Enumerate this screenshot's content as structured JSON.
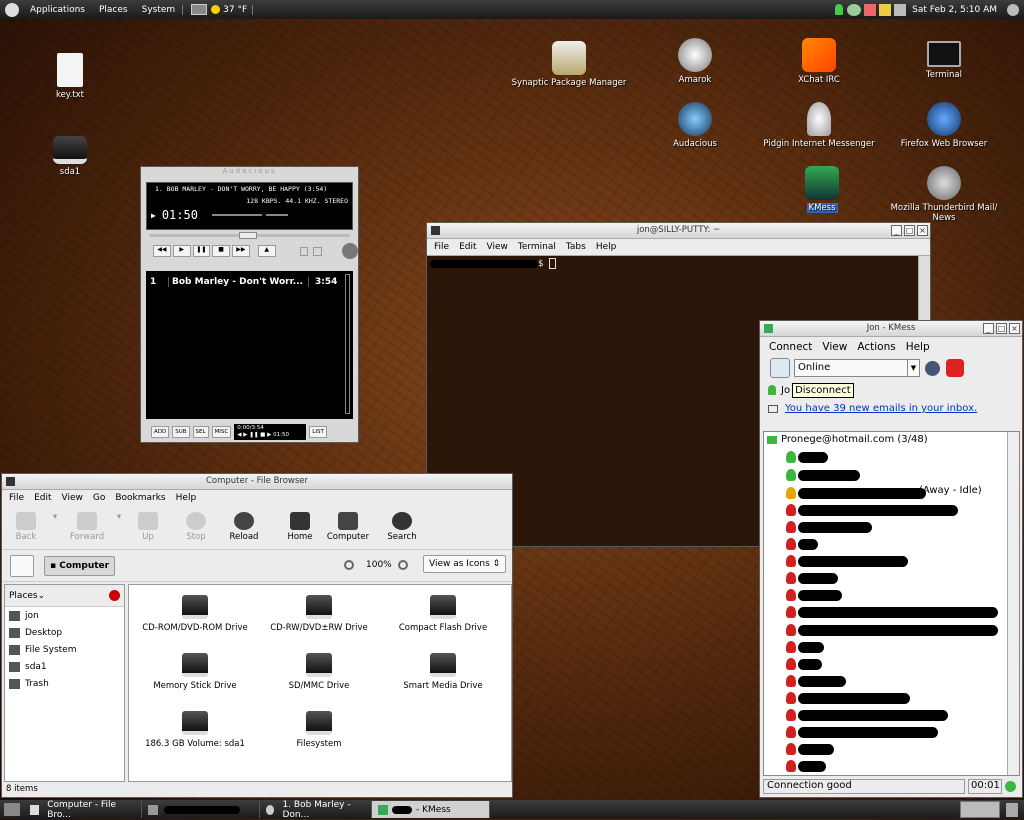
{
  "top_panel": {
    "menus": [
      "Applications",
      "Places",
      "System"
    ],
    "weather": "37 °F",
    "clock": "Sat Feb  2,  5:10 AM"
  },
  "desktop_icons": [
    {
      "label": "key.txt"
    },
    {
      "label": "sda1"
    },
    {
      "label": "Synaptic Package Manager"
    },
    {
      "label": "Amarok"
    },
    {
      "label": "XChat IRC"
    },
    {
      "label": "Terminal"
    },
    {
      "label": "Audacious"
    },
    {
      "label": "Pidgin Internet Messenger"
    },
    {
      "label": "Firefox Web Browser"
    },
    {
      "label": "KMess"
    },
    {
      "label": "Mozilla Thunderbird Mail/ News"
    }
  ],
  "audacious": {
    "track_info": "1. BOB MARLEY - DON'T WORRY, BE HAPPY (3:54)",
    "bitrate": "128 KBPS. 44.1 KHZ. STEREO",
    "time": "01:50",
    "playlist": [
      {
        "num": "1",
        "title": "Bob Marley - Don't Worr...",
        "duration": "3:54"
      }
    ],
    "pl_buttons": [
      "ADD",
      "SUB",
      "SEL",
      "MISC",
      "LIST"
    ],
    "pl_time": "0:00/3:54",
    "pl_elapsed": "01:50"
  },
  "terminal": {
    "title": "jon@SILLY-PUTTY: ~",
    "menus": [
      "File",
      "Edit",
      "View",
      "Terminal",
      "Tabs",
      "Help"
    ],
    "prompt": "$ "
  },
  "file_browser": {
    "title": "Computer - File Browser",
    "menus": [
      "File",
      "Edit",
      "View",
      "Go",
      "Bookmarks",
      "Help"
    ],
    "toolbar": [
      "Back",
      "Forward",
      "Up",
      "Stop",
      "Reload",
      "Home",
      "Computer",
      "Search"
    ],
    "location": "Computer",
    "zoom": "100%",
    "view_mode": "View as Icons",
    "places_label": "Places",
    "places": [
      "jon",
      "Desktop",
      "File System",
      "sda1",
      "Trash"
    ],
    "items": [
      "CD-ROM/DVD-ROM Drive",
      "CD-RW/DVD±RW Drive",
      "Compact Flash Drive",
      "Memory Stick Drive",
      "SD/MMC Drive",
      "Smart Media Drive",
      "186.3 GB Volume: sda1",
      "Filesystem"
    ],
    "status": "8 items"
  },
  "kmess": {
    "title": "Jon - KMess",
    "menus": [
      "Connect",
      "View",
      "Actions",
      "Help"
    ],
    "status_select": "Online",
    "tooltip": "Disconnect",
    "name_prefix": "Jo",
    "email_notice": "You have 39 new emails in your inbox.",
    "group": "Pronege@hotmail.com (3/48)",
    "away_text": "(Away - Idle)",
    "status_bar": "Connection good",
    "timer": "00:01"
  },
  "taskbar": [
    {
      "label": "Computer - File Bro..."
    },
    {
      "label": ""
    },
    {
      "label": "1. Bob Marley - Don..."
    },
    {
      "label": "- KMess"
    }
  ],
  "colors": {
    "online": "#3bb83b",
    "busy": "#d02020",
    "away": "#e0a800",
    "link": "#0033cc"
  }
}
